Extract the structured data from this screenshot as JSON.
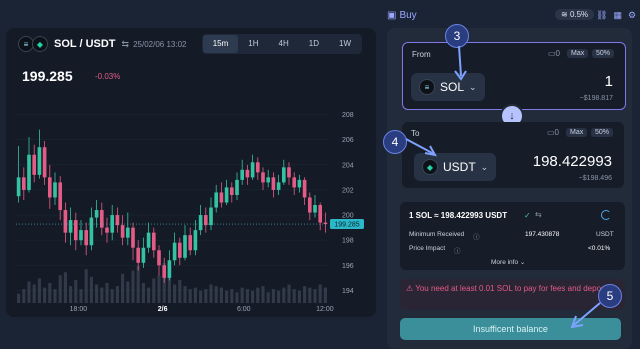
{
  "chart": {
    "pair": "SOL / USDT",
    "swap_glyph": "⇆",
    "datetime": "25/02/06 13:02",
    "timeframes": [
      "15m",
      "1H",
      "4H",
      "1D",
      "1W"
    ],
    "active_timeframe": "15m",
    "price": "199.285",
    "change": "-0.03%",
    "y_ticks": [
      "208",
      "206",
      "204",
      "202",
      "200",
      "198",
      "196",
      "194"
    ],
    "x_ticks": [
      "18:00",
      "2/6",
      "6:00",
      "12:00"
    ],
    "current_price_tag": "199.285"
  },
  "chart_data": {
    "type": "candlestick",
    "ylim": [
      193,
      209
    ],
    "yticks": [
      194,
      196,
      198,
      200,
      202,
      204,
      206,
      208
    ],
    "x_ticks": [
      "18:00",
      "2/6",
      "6:00",
      "12:00"
    ],
    "last_price": 199.285,
    "candles": [
      [
        201.5,
        203.0,
        205.5,
        201.0
      ],
      [
        203.0,
        202.0,
        203.8,
        201.2
      ],
      [
        202.0,
        204.8,
        206.2,
        201.8
      ],
      [
        204.8,
        203.2,
        205.6,
        202.6
      ],
      [
        203.2,
        205.4,
        206.8,
        202.9
      ],
      [
        205.4,
        203.0,
        205.9,
        202.4
      ],
      [
        203.0,
        201.4,
        204.0,
        200.5
      ],
      [
        201.4,
        202.6,
        203.4,
        200.8
      ],
      [
        202.6,
        200.4,
        203.1,
        199.6
      ],
      [
        200.4,
        198.6,
        201.0,
        197.8
      ],
      [
        198.6,
        199.6,
        200.6,
        197.6
      ],
      [
        199.6,
        198.0,
        200.2,
        197.2
      ],
      [
        198.0,
        198.8,
        199.6,
        197.6
      ],
      [
        198.8,
        197.6,
        199.4,
        196.8
      ],
      [
        197.6,
        199.8,
        200.6,
        197.2
      ],
      [
        199.8,
        200.4,
        201.2,
        199.0
      ],
      [
        200.4,
        199.0,
        201.0,
        198.4
      ],
      [
        199.0,
        198.6,
        199.8,
        197.8
      ],
      [
        198.6,
        200.0,
        200.8,
        198.0
      ],
      [
        200.0,
        199.2,
        200.6,
        198.6
      ],
      [
        199.2,
        198.2,
        200.0,
        197.6
      ],
      [
        198.2,
        199.0,
        200.2,
        197.6
      ],
      [
        199.0,
        197.4,
        199.4,
        196.4
      ],
      [
        197.4,
        196.2,
        198.0,
        195.6
      ],
      [
        196.2,
        197.4,
        198.2,
        195.8
      ],
      [
        197.4,
        198.6,
        199.4,
        197.0
      ],
      [
        198.6,
        197.2,
        199.0,
        196.6
      ],
      [
        197.2,
        196.0,
        197.6,
        195.2
      ],
      [
        196.0,
        195.0,
        196.6,
        194.6
      ],
      [
        195.0,
        196.4,
        197.2,
        194.8
      ],
      [
        196.4,
        197.8,
        198.6,
        196.0
      ],
      [
        197.8,
        196.6,
        198.2,
        196.0
      ],
      [
        196.6,
        198.4,
        199.2,
        196.4
      ],
      [
        198.4,
        197.2,
        199.0,
        196.8
      ],
      [
        197.2,
        198.8,
        199.6,
        196.8
      ],
      [
        198.8,
        200.0,
        200.8,
        198.4
      ],
      [
        200.0,
        199.2,
        200.6,
        198.6
      ],
      [
        199.2,
        200.6,
        201.4,
        198.8
      ],
      [
        200.6,
        201.8,
        202.4,
        200.2
      ],
      [
        201.8,
        201.0,
        202.6,
        200.6
      ],
      [
        201.0,
        202.2,
        202.8,
        200.8
      ],
      [
        202.2,
        201.6,
        202.6,
        201.0
      ],
      [
        201.6,
        202.8,
        203.4,
        201.2
      ],
      [
        202.8,
        203.6,
        204.4,
        202.4
      ],
      [
        203.6,
        203.0,
        204.0,
        202.4
      ],
      [
        203.0,
        204.2,
        204.8,
        202.8
      ],
      [
        204.2,
        203.4,
        204.6,
        202.8
      ],
      [
        203.4,
        202.6,
        203.8,
        202.0
      ],
      [
        202.6,
        203.0,
        203.6,
        202.2
      ],
      [
        203.0,
        202.0,
        203.4,
        201.4
      ],
      [
        202.0,
        202.6,
        203.2,
        201.6
      ],
      [
        202.6,
        203.8,
        204.4,
        202.4
      ],
      [
        203.8,
        203.0,
        204.2,
        202.4
      ],
      [
        203.0,
        202.2,
        203.4,
        201.6
      ],
      [
        202.2,
        202.8,
        203.2,
        201.8
      ],
      [
        202.8,
        201.4,
        203.0,
        200.8
      ],
      [
        201.4,
        200.2,
        201.8,
        199.6
      ],
      [
        200.2,
        200.8,
        201.6,
        199.8
      ],
      [
        200.8,
        199.4,
        201.0,
        198.8
      ],
      [
        199.4,
        199.285,
        200.2,
        198.6
      ]
    ],
    "volume": [
      6,
      9,
      14,
      12,
      16,
      10,
      13,
      9,
      18,
      20,
      11,
      15,
      9,
      22,
      17,
      12,
      10,
      13,
      9,
      11,
      19,
      14,
      21,
      24,
      13,
      10,
      16,
      18,
      26,
      20,
      12,
      15,
      11,
      9,
      10,
      8,
      9,
      12,
      11,
      10,
      8,
      9,
      7,
      10,
      9,
      8,
      10,
      11,
      7,
      9,
      8,
      10,
      12,
      9,
      8,
      11,
      10,
      9,
      12,
      10
    ]
  },
  "topbar": {
    "buy_label": "Buy",
    "slippage": "0.5%"
  },
  "swap": {
    "from": {
      "label": "From",
      "max_label": "Max",
      "pct_label": "50%",
      "token": "SOL",
      "amount": "1",
      "usd": "~$198.817"
    },
    "to": {
      "label": "To",
      "max_label": "Max",
      "pct_label": "50%",
      "token": "USDT",
      "amount": "198.422993",
      "usd": "~$198.496"
    },
    "rate": "1 SOL ≈ 198.422993 USDT",
    "min_received_label": "Minimum Received",
    "min_received_value": "197.430878",
    "min_received_unit": "USDT",
    "price_impact_label": "Price Impact",
    "price_impact_value": "<0.01%",
    "more_info": "More info",
    "warning": "You need at least 0.01 SOL to pay for fees and deposits",
    "cta": "Insufficent balance"
  },
  "callouts": [
    "3",
    "4",
    "5"
  ],
  "colors": {
    "up": "#35c2a3",
    "down": "#e35c86",
    "accent": "#8377e8",
    "cta": "#3a8f9a"
  }
}
